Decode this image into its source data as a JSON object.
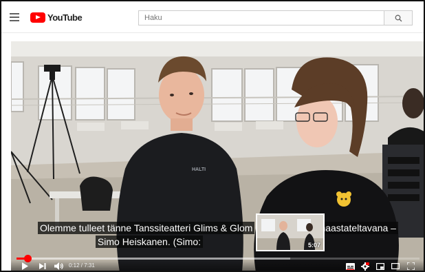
{
  "masthead": {
    "logo_text": "YouTube",
    "search_placeholder": "Haku"
  },
  "video": {
    "subtitle_line1": "Olemme tulleet tänne Tanssiteatteri Glims & Glom",
    "subtitle_line1_right": "haastateltavana –",
    "subtitle_line2": "Simo Heiskanen. (Simo:",
    "preview_time": "5:07",
    "current_time": "0:12",
    "duration": "7:31",
    "time_display": "0:12 / 7:31",
    "played_fraction": 0.027,
    "loaded_fraction": 0.68,
    "shirt_logo": "HALTI"
  },
  "colors": {
    "brand_red": "#ff0000",
    "progress_red": "#f00"
  },
  "icons": {
    "menu": "menu-icon",
    "search": "search-icon",
    "play": "play-icon",
    "next": "next-icon",
    "volume": "volume-icon",
    "captions": "captions-icon",
    "settings": "settings-icon",
    "miniplayer": "miniplayer-icon",
    "theater": "theater-icon",
    "fullscreen": "fullscreen-icon"
  }
}
